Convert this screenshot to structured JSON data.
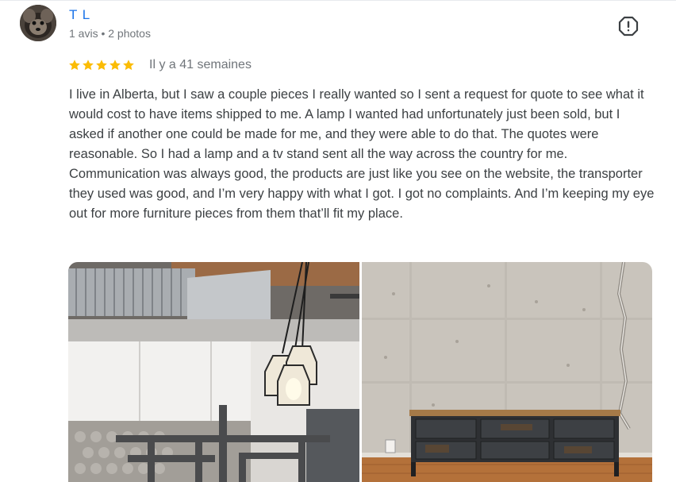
{
  "reviewer": {
    "name": "T L",
    "meta": "1 avis • 2 photos"
  },
  "rating": {
    "stars": 5,
    "max": 5,
    "color": "#fbbc04",
    "time_ago": "Il y a 41 semaines"
  },
  "review": {
    "text": "I live in Alberta, but I saw a couple pieces I really wanted so I sent a request for quote to see what it would cost to have items shipped to me. A lamp I wanted had unfortunately just been sold, but I asked if another one could be made for me, and they were able to do that. The quotes were reasonable. So I had a lamp and a tv stand sent all the way across the country for me. Communication was always good, the products are just like you see on the website, the transporter they used was good, and I’m very happy with what I got. I got no complaints. And I’m keeping my eye out for more furniture pieces from them that’ll fit my place."
  },
  "icons": {
    "flag": "report-flag-icon",
    "star": "star-icon"
  },
  "colors": {
    "name": "#1a73e8",
    "muted": "#70757a",
    "text": "#3c4043"
  }
}
